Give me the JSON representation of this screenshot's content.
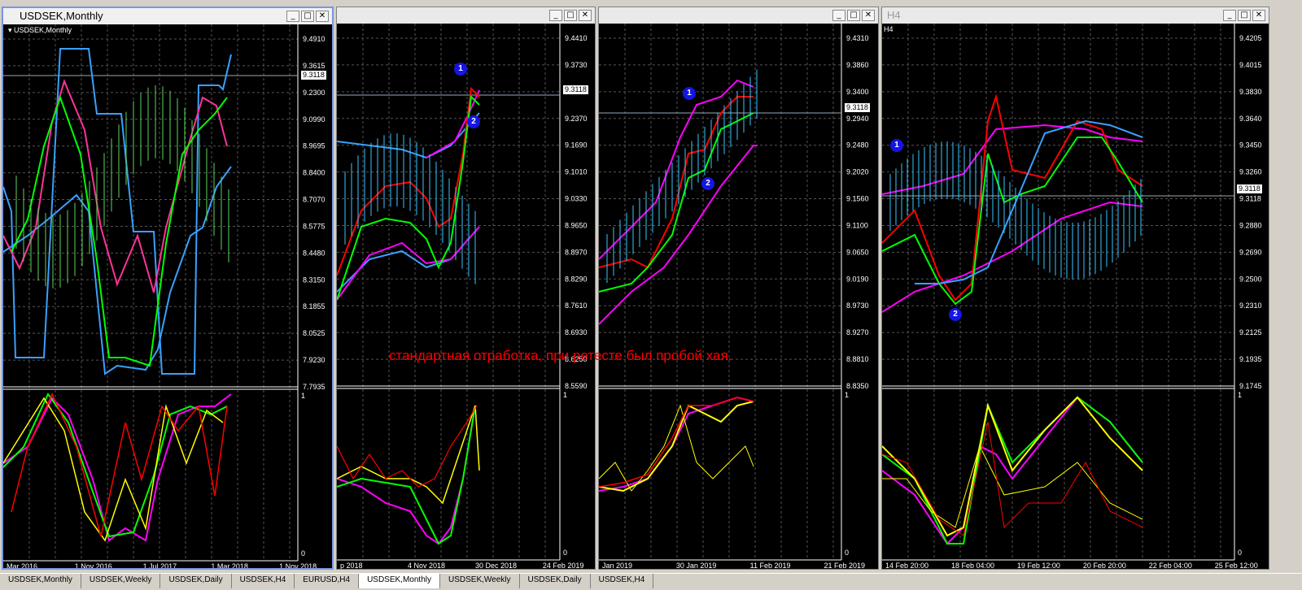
{
  "windows": [
    {
      "id": "w1",
      "title": "USDSEK,Monthly",
      "chart_label": "USDSEK,Monthly",
      "active": true,
      "prices": [
        "9.4910",
        "9.3615",
        "9.2300",
        "9.0990",
        "8.9695",
        "8.8400",
        "8.7070",
        "8.5775",
        "8.4480",
        "8.3150",
        "8.1855",
        "8.0525",
        "7.9230",
        "7.7935"
      ],
      "current_price": "9.3118",
      "osc_scale": [
        "1",
        "0"
      ],
      "dates": [
        "Mar 2016",
        "1 Nov 2016",
        "1 Jul 2017",
        "1 Mar 2018",
        "1 Nov 2018"
      ]
    },
    {
      "id": "w2",
      "title": "",
      "chart_label": "",
      "active": false,
      "prices": [
        "9.4410",
        "9.3730",
        "9.3118",
        "9.2370",
        "9.1690",
        "9.1010",
        "9.0330",
        "8.9650",
        "8.8970",
        "8.8290",
        "8.7610",
        "8.6930",
        "8.6250",
        "8.5590"
      ],
      "current_price": "9.3118",
      "osc_scale": [
        "1",
        "0"
      ],
      "dates": [
        "p 2018",
        "4 Nov 2018",
        "30 Dec 2018",
        "24 Feb 2019"
      ]
    },
    {
      "id": "w3",
      "title": "",
      "chart_label": "",
      "active": false,
      "prices": [
        "9.4310",
        "9.3860",
        "9.3400",
        "9.2940",
        "9.2480",
        "9.2020",
        "9.1560",
        "9.1100",
        "9.0650",
        "9.0190",
        "8.9730",
        "8.9270",
        "8.8810",
        "8.8350"
      ],
      "current_price": "9.3118",
      "osc_scale": [
        "1",
        "0"
      ],
      "dates": [
        "Jan 2019",
        "30 Jan 2019",
        "11 Feb 2019",
        "21 Feb 2019"
      ]
    },
    {
      "id": "w4",
      "title": "H4",
      "chart_label": "H4",
      "active": false,
      "prices": [
        "9.4205",
        "9.4015",
        "9.3830",
        "9.3640",
        "9.3450",
        "9.3260",
        "9.3118",
        "9.2880",
        "9.2690",
        "9.2500",
        "9.2310",
        "9.2125",
        "9.1935",
        "9.1745"
      ],
      "current_price": "9.3118",
      "osc_scale": [
        "1",
        "0"
      ],
      "dates": [
        "14 Feb 20:00",
        "18 Feb 04:00",
        "19 Feb 12:00",
        "20 Feb 20:00",
        "22 Feb 04:00",
        "25 Feb 12:00"
      ]
    }
  ],
  "titlebar_buttons": {
    "minimize": "_",
    "maximize": "□",
    "close": "✕"
  },
  "annotation": "стандартная отработка, при ретесте был пробой хая.",
  "markers": [
    "1",
    "2"
  ],
  "tabs": [
    "USDSEK,Monthly",
    "USDSEK,Weekly",
    "USDSEK,Daily",
    "USDSEK,H4",
    "EURUSD,H4",
    "USDSEK,Monthly",
    "USDSEK,Weekly",
    "USDSEK,Daily",
    "USDSEK,H4"
  ],
  "colors": {
    "green": "#00ff00",
    "red": "#ff0000",
    "magenta": "#ff00ff",
    "blue": "#3aa0ff",
    "yellow": "#ffff00",
    "bars": "#39c6ff",
    "pink": "#ff3399"
  }
}
